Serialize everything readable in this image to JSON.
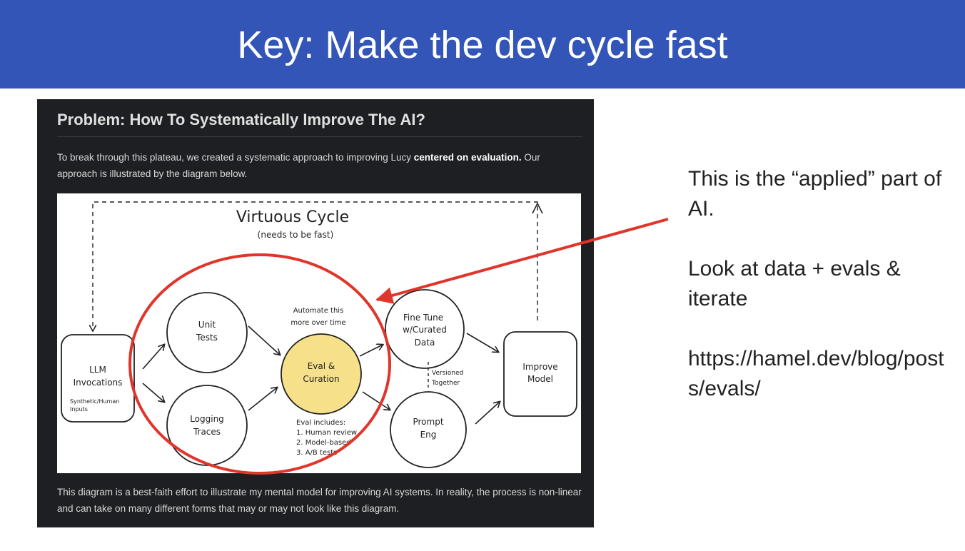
{
  "slide": {
    "title": "Key: Make the dev cycle fast"
  },
  "screenshot": {
    "heading": "Problem: How To Systematically Improve The AI?",
    "intro_part1": "To break through this plateau, we created a systematic approach to improving Lucy ",
    "intro_bold1": "centered on evaluation.",
    "intro_part2": " Our approach is illustrated by the diagram below.",
    "outro": "This diagram is a best-faith effort to illustrate my mental model for improving AI systems. In reality, the process is non-linear and can take on many different forms that may or may not look like this diagram."
  },
  "diagram": {
    "title": "Virtuous Cycle",
    "subtitle": "(needs to be fast)",
    "llm_line1": "LLM",
    "llm_line2": "Invocations",
    "llm_note1": "Synthetic/Human",
    "llm_note2": "Inputs",
    "unit_line1": "Unit",
    "unit_line2": "Tests",
    "logging_line1": "Logging",
    "logging_line2": "Traces",
    "automate_line1": "Automate this",
    "automate_line2": "more over time",
    "eval_line1": "Eval &",
    "eval_line2": "Curation",
    "eval_includes": "Eval includes:",
    "eval_item1": "1. Human review",
    "eval_item2": "2. Model-based",
    "eval_item3": "3. A/B tests",
    "finetune_line1": "Fine Tune",
    "finetune_line2": "w/Curated",
    "finetune_line3": "Data",
    "versioned_line1": "Versioned",
    "versioned_line2": "Together",
    "prompt_line1": "Prompt",
    "prompt_line2": "Eng",
    "improve_line1": "Improve",
    "improve_line2": "Model",
    "highlight_color": "#f7e08a",
    "annotation_color": "#e0352b"
  },
  "notes": {
    "line1": "This is the “applied” part of AI.",
    "line2": "Look at data + evals & iterate",
    "line3": "https://hamel.dev/blog/posts/evals/"
  },
  "colors": {
    "banner": "#3355b8",
    "screenshot_bg": "#1e1f22"
  }
}
